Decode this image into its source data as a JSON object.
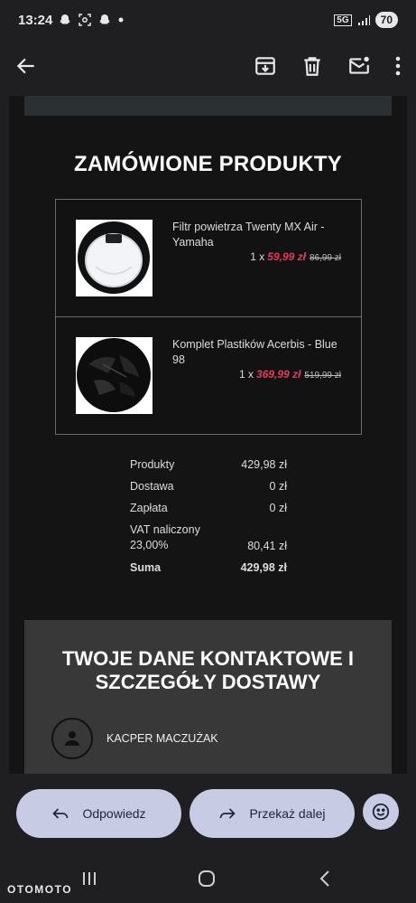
{
  "status_bar": {
    "time": "13:24",
    "network": "5G",
    "battery": "70"
  },
  "toolbar": {
    "back_icon": "arrow-left-icon",
    "archive_icon": "archive-icon",
    "delete_icon": "trash-icon",
    "mark_unread_icon": "mail-unread-icon",
    "more_icon": "more-vert-icon"
  },
  "email": {
    "section_title": "ZAMÓWIONE PRODUKTY",
    "products": [
      {
        "name": "Filtr powietrza Twenty MX Air - Yamaha",
        "qty": "1 x",
        "price": "59,99 zł",
        "old_price": "86,99 zł"
      },
      {
        "name": "Komplet Plastików Acerbis - Blue 98",
        "qty": "1 x",
        "price": "369,99 zł",
        "old_price": "519,99 zł"
      }
    ],
    "summary": [
      {
        "label": "Produkty",
        "value": "429,98 zł"
      },
      {
        "label": "Dostawa",
        "value": "0 zł"
      },
      {
        "label": "Zapłata",
        "value": "0 zł"
      },
      {
        "label": "VAT naliczony 23,00%",
        "value": "80,41 zł"
      },
      {
        "label": "Suma",
        "value": "429,98 zł"
      }
    ],
    "contact_title": "TWOJE DANE KONTAKTOWE I SZCZEGÓŁY DOSTAWY",
    "contact_name": "KACPER MACZUŻAK"
  },
  "actions": {
    "reply": "Odpowiedz",
    "forward": "Przekaż dalej",
    "emoji_icon": "emoji-icon"
  },
  "watermark": "OTOMOTO",
  "colors": {
    "sale_price": "#e23b5a",
    "action_pill": "#c7cbe4"
  }
}
